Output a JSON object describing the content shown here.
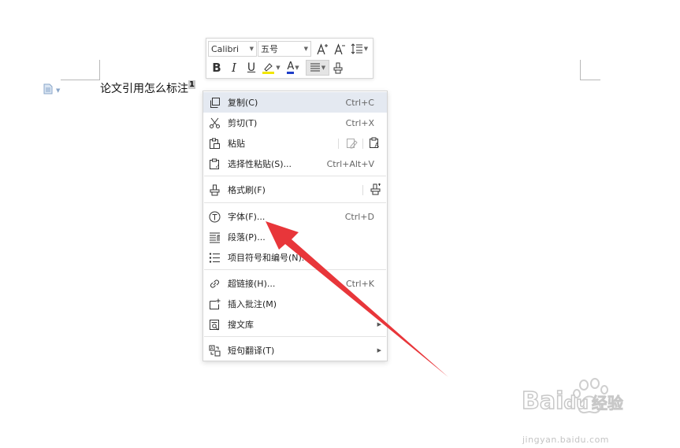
{
  "document": {
    "text": "论文引用怎么标注",
    "selected_superscript": "1"
  },
  "minibar": {
    "font_name": "Calibri",
    "font_size": "五号",
    "bold_label": "B",
    "italic_label": "I",
    "underline_label": "U",
    "font_color_label": "A",
    "highlight_color": "#f2e600",
    "font_color": "#1e3ec9"
  },
  "context_menu": {
    "items": [
      {
        "label": "复制(C)",
        "shortcut": "Ctrl+C"
      },
      {
        "label": "剪切(T)",
        "shortcut": "Ctrl+X"
      },
      {
        "label": "粘贴",
        "shortcut": ""
      },
      {
        "label": "选择性粘贴(S)...",
        "shortcut": "Ctrl+Alt+V"
      },
      {
        "label": "格式刷(F)",
        "shortcut": ""
      },
      {
        "label": "字体(F)...",
        "shortcut": "Ctrl+D"
      },
      {
        "label": "段落(P)...",
        "shortcut": ""
      },
      {
        "label": "项目符号和编号(N)...",
        "shortcut": ""
      },
      {
        "label": "超链接(H)...",
        "shortcut": "Ctrl+K"
      },
      {
        "label": "插入批注(M)",
        "shortcut": ""
      },
      {
        "label": "搜文库",
        "shortcut": ""
      },
      {
        "label": "短句翻译(T)",
        "shortcut": ""
      }
    ]
  },
  "watermark": {
    "brand_left": "Bai",
    "brand_right": "du",
    "brand_cn": "经验",
    "site": "jingyan.baidu.com"
  },
  "colors": {
    "arrow": "#e8363a",
    "menu_highlight": "#e4e9f1",
    "doc_icon": "#8aa6c8"
  }
}
